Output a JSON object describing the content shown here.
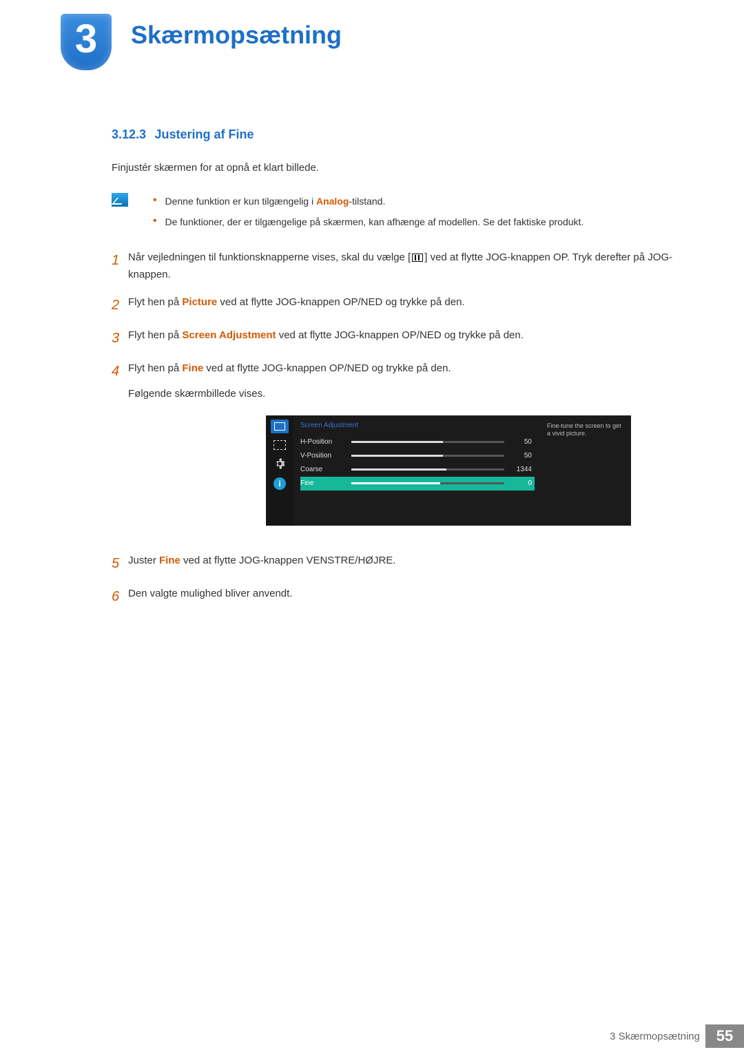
{
  "chapter": {
    "number": "3",
    "title": "Skærmopsætning"
  },
  "section": {
    "number": "3.12.3",
    "title": "Justering af Fine"
  },
  "intro": "Finjustér skærmen for at opnå et klart billede.",
  "notes": {
    "item1_pre": "Denne funktion er kun tilgængelig i ",
    "item1_hl": "Analog",
    "item1_post": "-tilstand.",
    "item2": "De funktioner, der er tilgængelige på skærmen, kan afhænge af modellen. Se det faktiske produkt."
  },
  "steps": {
    "s1_a": "Når vejledningen til funktionsknapperne vises, skal du vælge [",
    "s1_b": "] ved at flytte JOG-knappen OP. Tryk derefter på JOG-knappen.",
    "s2_a": "Flyt hen på ",
    "s2_hl": "Picture",
    "s2_b": " ved at flytte JOG-knappen OP/NED og trykke på den.",
    "s3_a": "Flyt hen på ",
    "s3_hl": "Screen Adjustment",
    "s3_b": " ved at flytte JOG-knappen OP/NED og trykke på den.",
    "s4_a": "Flyt hen på ",
    "s4_hl": "Fine",
    "s4_b": " ved at flytte JOG-knappen OP/NED og trykke på den.",
    "s4_c": "Følgende skærmbillede vises.",
    "s5_a": "Juster ",
    "s5_hl": "Fine",
    "s5_b": " ved at flytte JOG-knappen VENSTRE/HØJRE.",
    "s6": "Den valgte mulighed bliver anvendt.",
    "n1": "1",
    "n2": "2",
    "n3": "3",
    "n4": "4",
    "n5": "5",
    "n6": "6"
  },
  "osd": {
    "title": "Screen Adjustment",
    "rows": [
      {
        "label": "H-Position",
        "value": "50",
        "pct": 60
      },
      {
        "label": "V-Position",
        "value": "50",
        "pct": 60
      },
      {
        "label": "Coarse",
        "value": "1344",
        "pct": 62
      },
      {
        "label": "Fine",
        "value": "0",
        "pct": 58
      }
    ],
    "desc": "Fine-tune the screen to get a vivid picture.",
    "info_letter": "i"
  },
  "footer": {
    "text": "3 Skærmopsætning",
    "page": "55"
  }
}
